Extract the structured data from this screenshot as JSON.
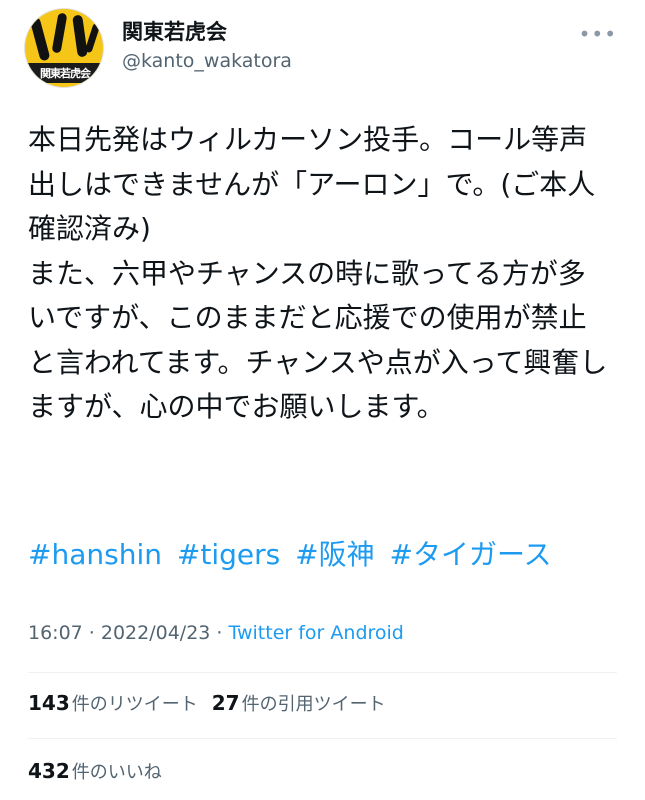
{
  "tweet": {
    "author": {
      "display_name": "関東若虎会",
      "handle": "@kanto_wakatora",
      "avatar_text": "関東若虎会"
    },
    "more_icon": "more-horizontal-icon",
    "body": [
      "本日先発はウィルカーソン投手。コール等声出しはできませんが「アーロン」で。(ご本人確認済み)",
      "また、六甲やチャンスの時に歌ってる方が多いですが、このままだと応援での使用が禁止と言われてます。チャンスや点が入って興奮しますが、心の中でお願いします。"
    ],
    "hashtags": [
      "#hanshin",
      "#tigers",
      "#阪神",
      "#タイガース"
    ],
    "timestamp": "16:07 · 2022/04/23 · ",
    "source": "Twitter for Android",
    "retweets": {
      "count": "143",
      "label": "件のリツイート"
    },
    "quotes": {
      "count": "27",
      "label": "件の引用ツイート"
    },
    "likes": {
      "count": "432",
      "label": "件のいいね"
    }
  },
  "colors": {
    "link": "#1d9bf0",
    "secondary_text": "#536471",
    "primary_text": "#0f1419",
    "avatar_bg": "#f5c518"
  }
}
